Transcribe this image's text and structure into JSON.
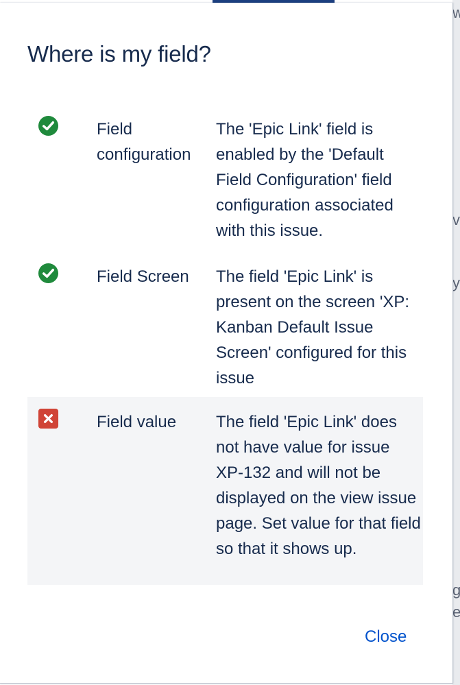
{
  "dialog": {
    "title": "Where is my field?",
    "rows": [
      {
        "status": "ok",
        "icon": "check-circle-icon",
        "label": "Field configuration",
        "description": "The 'Epic Link' field is enabled by the 'Default Field Configuration' field configuration associated with this issue."
      },
      {
        "status": "ok",
        "icon": "check-circle-icon",
        "label": "Field Screen",
        "description": "The field 'Epic Link' is present on the screen 'XP: Kanban Default Issue Screen' configured for this issue"
      },
      {
        "status": "error",
        "icon": "error-x-icon",
        "label": "Field value",
        "description": "The field 'Epic Link' does not have value for issue XP-132 and will not be displayed on the view issue page. Set value for that field so that it shows up."
      }
    ],
    "close_label": "Close"
  },
  "colors": {
    "ok": "#1f8a3c",
    "error": "#d04437",
    "link": "#0052cc",
    "text": "#172b4d"
  }
}
